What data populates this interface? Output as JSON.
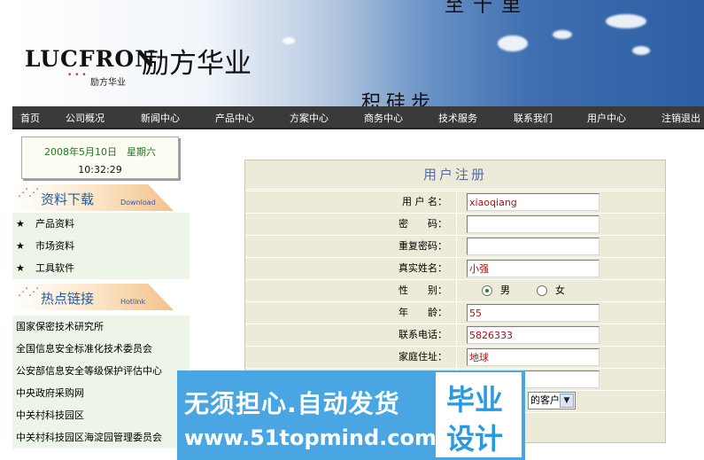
{
  "header": {
    "logo_en": "LUCFRON",
    "logo_cn": "励方华业",
    "logo_sub": "励方华业",
    "slogan_top": "至十里",
    "slogan_bottom": "积硅步"
  },
  "nav": [
    "首页",
    "公司概况",
    "新闻中心",
    "产品中心",
    "方案中心",
    "商务中心",
    "技术服务",
    "联系我们",
    "用户中心",
    "注销退出"
  ],
  "datebox": {
    "date": "2008年5月10日　星期六",
    "time": "10:32:29"
  },
  "downloads": {
    "title": "资料下载",
    "title_en": "Download",
    "items": [
      "产品资料",
      "市场资料",
      "工具软件"
    ]
  },
  "hotlinks": {
    "title": "热点链接",
    "title_en": "Hotlink",
    "items": [
      "国家保密技术研究所",
      "全国信息安全标准化技术委员会",
      "公安部信息安全等级保护评估中心",
      "中央政府采购网",
      "中关村科技园区",
      "中关村科技园区海淀园管理委员会"
    ]
  },
  "form": {
    "title": "用户注册",
    "username_label": "用 户 名：",
    "username_value": "xiaoqiang",
    "password_label": "密　　码：",
    "password_value": "",
    "repassword_label": "重复密码：",
    "repassword_value": "",
    "realname_label": "真实姓名：",
    "realname_value": "小强",
    "gender_label": "性　　别：",
    "gender_male": "男",
    "gender_female": "女",
    "age_label": "年　　龄：",
    "age_value": "55",
    "phone_label": "联系电话：",
    "phone_value": "5826333",
    "address_label": "家庭住址：",
    "address_value": "地球",
    "email_value_partial": "m",
    "select_value": "的客户"
  },
  "watermark": {
    "line1": "无须担心.自动发货",
    "line2": "www.51topmind.com",
    "box1": "毕业",
    "box2": "设计"
  },
  "colors": {
    "nav_bg": "#3a3a3a",
    "form_bg": "#ecebd7",
    "input_text": "#a11515",
    "watermark_bg": "#4aa6e2"
  }
}
